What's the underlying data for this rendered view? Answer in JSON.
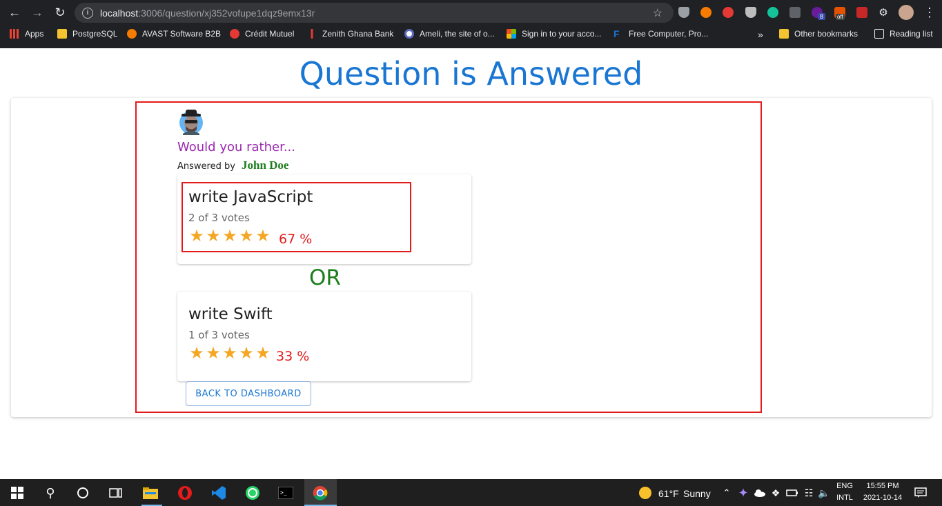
{
  "browser": {
    "url_host": "localhost",
    "url_path": ":3006/question/xj352vofupe1dqz9emx13r",
    "extension_badges": {
      "ext_count": "8",
      "ext_off": "off"
    },
    "bookmarks": [
      {
        "label": "Apps",
        "icon": "apps-grid-icon",
        "color": "#ea4335"
      },
      {
        "label": "PostgreSQL",
        "icon": "folder-icon",
        "color": "#f4c430"
      },
      {
        "label": "AVAST Software B2B",
        "icon": "avast-icon",
        "color": "#f57c00"
      },
      {
        "label": "Crédit Mutuel",
        "icon": "credit-mutuel-icon",
        "color": "#e53935"
      },
      {
        "label": "Zenith Ghana Bank",
        "icon": "zenith-icon",
        "color": "#e53935"
      },
      {
        "label": "Ameli, the site of o...",
        "icon": "ameli-icon",
        "color": "#5c6bc0"
      },
      {
        "label": "Sign in to your acco...",
        "icon": "microsoft-icon",
        "color": "#00a4ef"
      },
      {
        "label": "Free Computer, Pro...",
        "icon": "f-icon",
        "color": "#1976d2"
      }
    ],
    "overflow": "»",
    "other_bookmarks": "Other bookmarks",
    "reading_list": "Reading list"
  },
  "page": {
    "title": "Question is Answered",
    "prompt": "Would you rather...",
    "answered_by_label": "Answered by",
    "author": "John Doe",
    "options": [
      {
        "text": "write JavaScript",
        "votes": "2 of 3 votes",
        "percent": "67 %",
        "stars": 5,
        "selected": true
      },
      {
        "text": "write Swift",
        "votes": "1 of 3 votes",
        "percent": "33 %",
        "stars": 5,
        "selected": false
      }
    ],
    "or": "OR",
    "back_button": "BACK TO DASHBOARD"
  },
  "taskbar": {
    "weather_temp": "61°F",
    "weather_text": "Sunny",
    "lang_top": "ENG",
    "lang_bottom": "INTL",
    "time": "15:55 PM",
    "date": "2021-10-14"
  },
  "colors": {
    "accent": "#1976d2",
    "prompt": "#9c27b0",
    "author": "#1b7d1b",
    "percent": "#e41b1b",
    "star": "#f5a623"
  }
}
